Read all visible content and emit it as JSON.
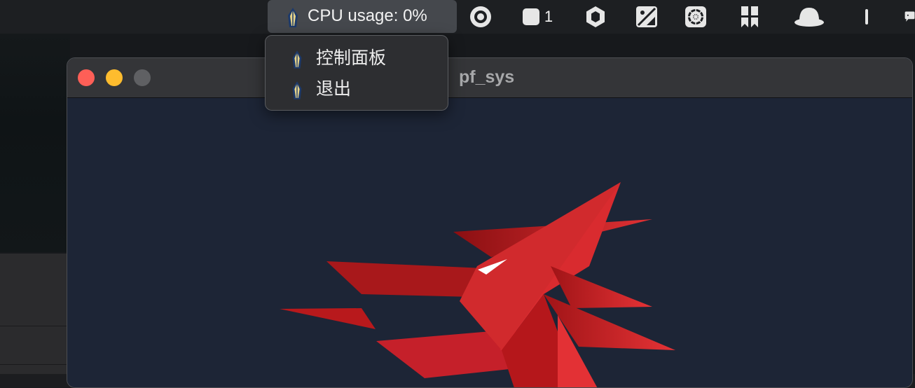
{
  "menubar": {
    "cpu_label": "CPU usage: 0%",
    "cpu_app_icon": "pen-nib-icon",
    "status_icons": [
      {
        "name": "record-icon"
      },
      {
        "name": "square-icon",
        "count": "1"
      },
      {
        "name": "hexagon-icon"
      },
      {
        "name": "image-slash-icon"
      },
      {
        "name": "gear-wheel-icon"
      },
      {
        "name": "bookmark-icon"
      },
      {
        "name": "bowl-icon"
      },
      {
        "name": "vertical-bar-icon"
      },
      {
        "name": "chat-bubble-icon"
      }
    ]
  },
  "dropdown": {
    "items": [
      {
        "label": "控制面板",
        "icon": "pen-nib-icon"
      },
      {
        "label": "退出",
        "icon": "pen-nib-icon"
      }
    ]
  },
  "window": {
    "title": "pf_sys",
    "controls": [
      "close",
      "minimize",
      "zoom"
    ],
    "background_color": "#1d2536",
    "logo_colors": [
      "#e03134",
      "#8b0f12",
      "#b8191c"
    ]
  }
}
